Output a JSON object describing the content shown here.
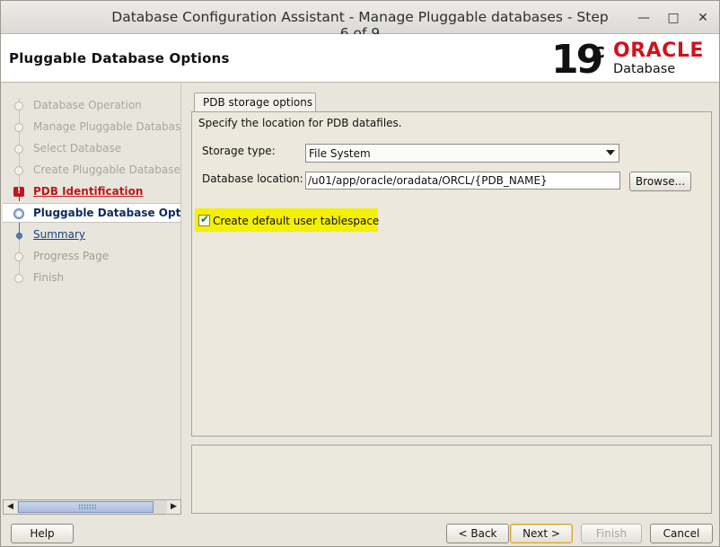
{
  "window": {
    "title": "Database Configuration Assistant - Manage Pluggable databases - Step 6 of 9",
    "minimize_glyph": "—",
    "maximize_glyph": "□",
    "close_glyph": "✕"
  },
  "header": {
    "title": "Pluggable Database Options",
    "logo": {
      "version": "19",
      "version_suffix": "c",
      "brand": "ORACLE",
      "product": "Database",
      "brand_color": "#d0121b"
    }
  },
  "sidebar": {
    "steps": [
      {
        "label": "Database Operation",
        "state": "done"
      },
      {
        "label": "Manage Pluggable Databases",
        "state": "done"
      },
      {
        "label": "Select Database",
        "state": "done"
      },
      {
        "label": "Create Pluggable Database",
        "state": "done"
      },
      {
        "label": "PDB Identification",
        "state": "error"
      },
      {
        "label": "Pluggable Database Options",
        "state": "current"
      },
      {
        "label": "Summary",
        "state": "next"
      },
      {
        "label": "Progress Page",
        "state": "pending"
      },
      {
        "label": "Finish",
        "state": "pending"
      }
    ]
  },
  "tabs": [
    {
      "label": "PDB storage options",
      "selected": true
    }
  ],
  "storage": {
    "intro": "Specify the location for PDB datafiles.",
    "storage_type_label": "Storage type:",
    "storage_type_value": "File System",
    "db_location_label": "Database location:",
    "db_location_value": "/u01/app/oracle/oradata/ORCL/{PDB_NAME}",
    "browse_label": "Browse...",
    "create_tablespace_label": "Create default user tablespace",
    "create_tablespace_checked": true,
    "highlight_color": "#f4f100"
  },
  "footer": {
    "help": "Help",
    "back": "< Back",
    "next": "Next >",
    "finish": "Finish",
    "cancel": "Cancel"
  }
}
